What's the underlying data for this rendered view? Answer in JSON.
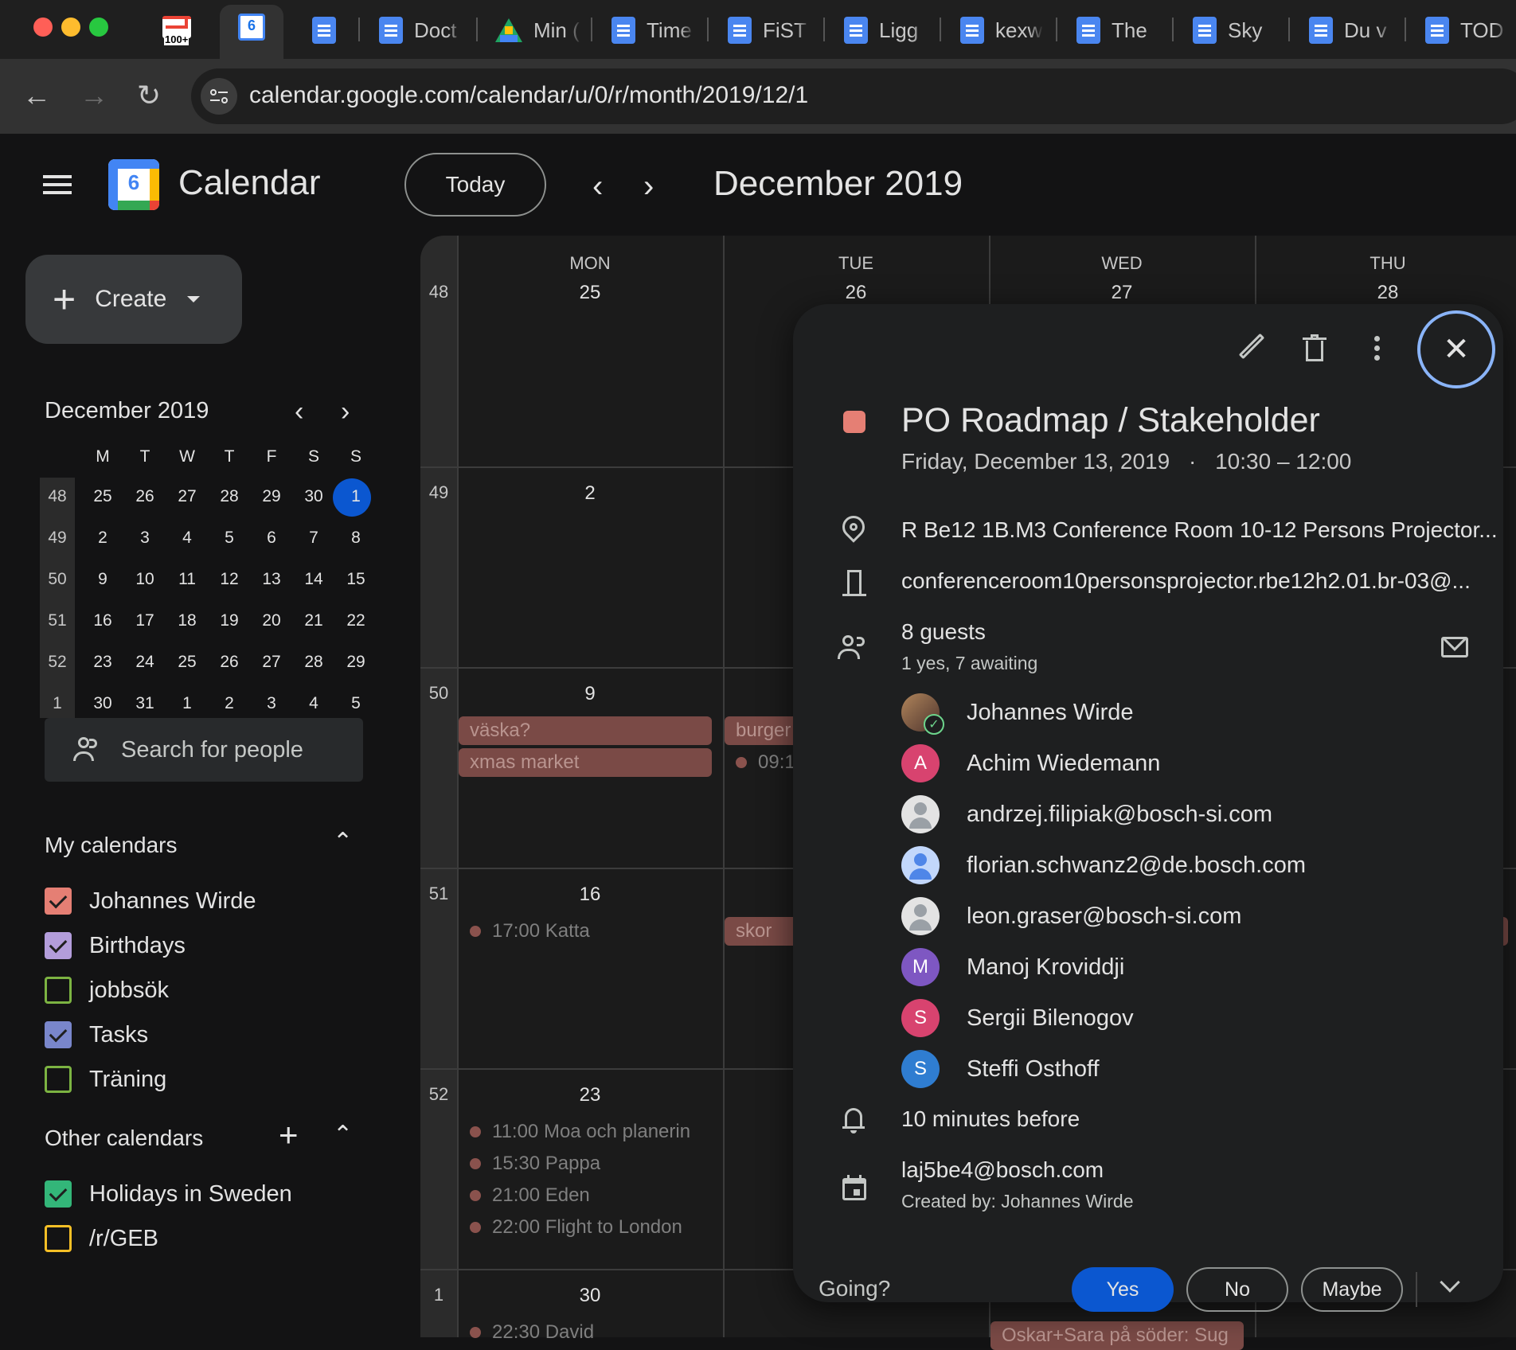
{
  "browser": {
    "tabs": [
      {
        "label": ""
      },
      {
        "label": ""
      },
      {
        "label": ""
      },
      {
        "label": "Doct"
      },
      {
        "label": "Min ("
      },
      {
        "label": "Time"
      },
      {
        "label": "FiST"
      },
      {
        "label": "Ligg"
      },
      {
        "label": "kexw"
      },
      {
        "label": "The"
      },
      {
        "label": "Sky"
      },
      {
        "label": "Du v"
      },
      {
        "label": "TOD"
      }
    ],
    "gmail_badge": "100+",
    "calendar_tab_day": "6",
    "url": "calendar.google.com/calendar/u/0/r/month/2019/12/1"
  },
  "header": {
    "app_name": "Calendar",
    "logo_day": "6",
    "today_label": "Today",
    "month_title": "December 2019"
  },
  "sidebar": {
    "create_label": "Create",
    "mini_cal": {
      "title": "December 2019",
      "weekdays": [
        "M",
        "T",
        "W",
        "T",
        "F",
        "S",
        "S"
      ],
      "weeks": [
        {
          "wk": "48",
          "days": [
            "25",
            "26",
            "27",
            "28",
            "29",
            "30",
            "1"
          ]
        },
        {
          "wk": "49",
          "days": [
            "2",
            "3",
            "4",
            "5",
            "6",
            "7",
            "8"
          ]
        },
        {
          "wk": "50",
          "days": [
            "9",
            "10",
            "11",
            "12",
            "13",
            "14",
            "15"
          ]
        },
        {
          "wk": "51",
          "days": [
            "16",
            "17",
            "18",
            "19",
            "20",
            "21",
            "22"
          ]
        },
        {
          "wk": "52",
          "days": [
            "23",
            "24",
            "25",
            "26",
            "27",
            "28",
            "29"
          ]
        },
        {
          "wk": "1",
          "days": [
            "30",
            "31",
            "1",
            "2",
            "3",
            "4",
            "5"
          ]
        }
      ]
    },
    "search_people_placeholder": "Search for people",
    "my_calendars_title": "My calendars",
    "my_calendars": [
      {
        "name": "Johannes Wirde",
        "color": "#e57f74",
        "checked": true
      },
      {
        "name": "Birthdays",
        "color": "#b39ddb",
        "checked": true
      },
      {
        "name": "jobbsök",
        "color": "#7cb342",
        "checked": false
      },
      {
        "name": "Tasks",
        "color": "#7986cb",
        "checked": true
      },
      {
        "name": "Träning",
        "color": "#7cb342",
        "checked": false
      }
    ],
    "other_calendars_title": "Other calendars",
    "other_calendars": [
      {
        "name": "Holidays in Sweden",
        "color": "#33b679",
        "checked": true
      },
      {
        "name": "/r/GEB",
        "color": "#f6bf26",
        "checked": false
      }
    ]
  },
  "grid": {
    "columns": [
      {
        "dow": "MON",
        "date": "25"
      },
      {
        "dow": "TUE",
        "date": "26"
      },
      {
        "dow": "WED",
        "date": "27"
      },
      {
        "dow": "THU",
        "date": "28"
      }
    ],
    "week_numbers": [
      "48",
      "49",
      "50",
      "51",
      "52",
      "1"
    ],
    "mon_dates": [
      "25",
      "2",
      "9",
      "16",
      "23",
      "30"
    ],
    "chips": {
      "vaska": "väska?",
      "xmas": "xmas market",
      "burger": "burger",
      "skor": "skor"
    },
    "events": {
      "tue_0915": "09:1",
      "katta": "17:00 Katta",
      "moa": "11:00 Moa och planerin",
      "pappa": "15:30 Pappa",
      "eden": "21:00 Eden",
      "flight": "22:00 Flight to London",
      "david": "22:30 David",
      "oskar": "Oskar+Sara på söder: Sug"
    }
  },
  "event": {
    "title": "PO Roadmap / Stakeholder",
    "date": "Friday, December 13, 2019",
    "separator": "·",
    "time": "10:30 – 12:00",
    "color": "#e57f74",
    "location": "R Be12 1B.M3 Conference Room 10-12 Persons Projector...",
    "room_email": "conferenceroom10personsprojector.rbe12h2.01.br-03@...",
    "guests_count": "8 guests",
    "guests_status": "1 yes, 7 awaiting",
    "guests": [
      {
        "name": "Johannes Wirde",
        "initial": "",
        "avatar": "photo",
        "color": "#8d6e63"
      },
      {
        "name": "Achim Wiedemann",
        "initial": "A",
        "avatar": "letter",
        "color": "#d8436f"
      },
      {
        "name": "andrzej.filipiak@bosch-si.com",
        "initial": "",
        "avatar": "grey",
        "color": "#e3e3e3"
      },
      {
        "name": "florian.schwanz2@de.bosch.com",
        "initial": "",
        "avatar": "blue",
        "color": "#4f86e8"
      },
      {
        "name": "leon.graser@bosch-si.com",
        "initial": "",
        "avatar": "grey",
        "color": "#e3e3e3"
      },
      {
        "name": "Manoj Kroviddji",
        "initial": "M",
        "avatar": "letter",
        "color": "#7e57c2"
      },
      {
        "name": "Sergii Bilenogov",
        "initial": "S",
        "avatar": "letter",
        "color": "#d8436f"
      },
      {
        "name": "Steffi Osthoff",
        "initial": "S",
        "avatar": "letter",
        "color": "#2f7dd1"
      }
    ],
    "reminder": "10 minutes before",
    "calendar_owner": "laj5be4@bosch.com",
    "created_by": "Created by: Johannes Wirde",
    "going_label": "Going?",
    "yes_label": "Yes",
    "no_label": "No",
    "maybe_label": "Maybe"
  }
}
